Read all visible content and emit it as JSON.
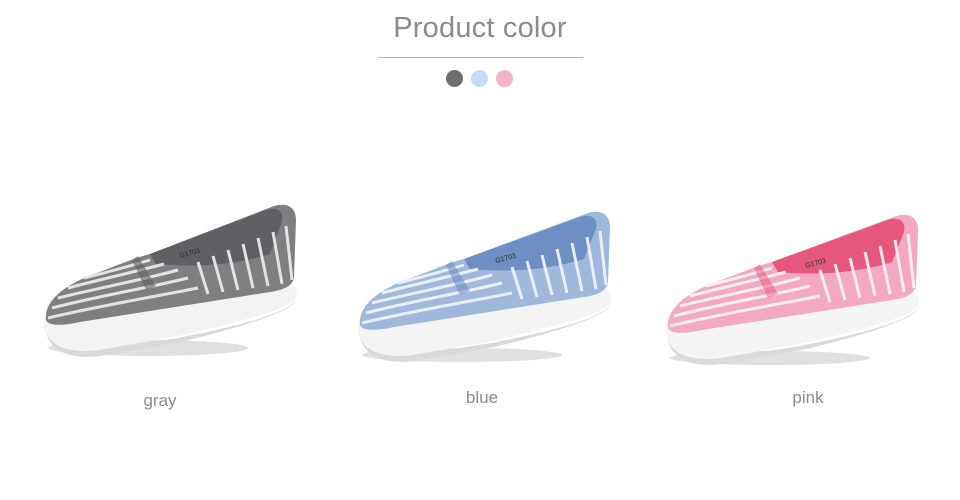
{
  "header": {
    "title": "Product color"
  },
  "swatches": [
    {
      "name": "gray",
      "color": "#6e6e6e"
    },
    {
      "name": "blue",
      "color": "#c9d9f2"
    },
    {
      "name": "pink",
      "color": "#f3b4c6"
    }
  ],
  "products": [
    {
      "label": "gray",
      "model_code": "G1703",
      "colors": {
        "upper": "#7f7f82",
        "stripe": "#e9e9ea",
        "lining": "#5f6063",
        "sole": "#f3f3f3",
        "sole_edge": "#d9d9d9"
      }
    },
    {
      "label": "blue",
      "model_code": "G1703",
      "colors": {
        "upper": "#9fb8dc",
        "stripe": "#eef3fb",
        "lining": "#6f8fc4",
        "sole": "#f4f4f4",
        "sole_edge": "#d9d9d9"
      }
    },
    {
      "label": "pink",
      "model_code": "G1703",
      "colors": {
        "upper": "#f3a9c1",
        "stripe": "#fdf1f5",
        "lining": "#e5577c",
        "sole": "#f5f5f5",
        "sole_edge": "#dadada"
      }
    }
  ]
}
